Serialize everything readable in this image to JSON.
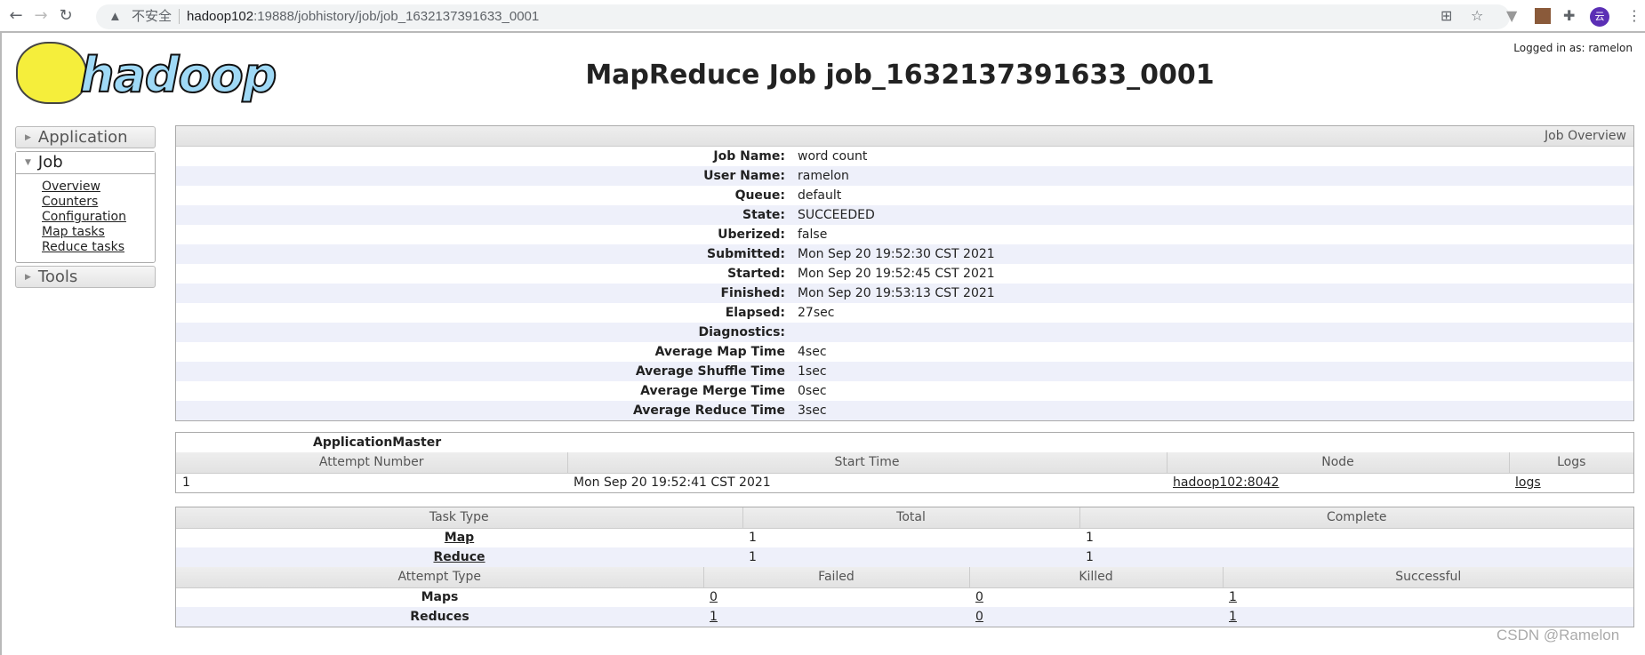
{
  "browser": {
    "insecure_label": "不安全",
    "url_host": "hadoop102",
    "url_rest": ":19888/jobhistory/job/job_1632137391633_0001",
    "avatar_letter": "云"
  },
  "header": {
    "logo_text": "hadoop",
    "title": "MapReduce Job job_1632137391633_0001",
    "logged_in": "Logged in as: ramelon"
  },
  "sidebar": {
    "application": "Application",
    "job": "Job",
    "tools": "Tools",
    "job_links": [
      "Overview",
      "Counters",
      "Configuration",
      "Map tasks",
      "Reduce tasks"
    ]
  },
  "overview": {
    "heading": "Job Overview",
    "rows": [
      {
        "k": "Job Name:",
        "v": "word count"
      },
      {
        "k": "User Name:",
        "v": "ramelon"
      },
      {
        "k": "Queue:",
        "v": "default"
      },
      {
        "k": "State:",
        "v": "SUCCEEDED"
      },
      {
        "k": "Uberized:",
        "v": "false"
      },
      {
        "k": "Submitted:",
        "v": "Mon Sep 20 19:52:30 CST 2021"
      },
      {
        "k": "Started:",
        "v": "Mon Sep 20 19:52:45 CST 2021"
      },
      {
        "k": "Finished:",
        "v": "Mon Sep 20 19:53:13 CST 2021"
      },
      {
        "k": "Elapsed:",
        "v": "27sec"
      },
      {
        "k": "Diagnostics:",
        "v": ""
      },
      {
        "k": "Average Map Time",
        "v": "4sec"
      },
      {
        "k": "Average Shuffle Time",
        "v": "1sec"
      },
      {
        "k": "Average Merge Time",
        "v": "0sec"
      },
      {
        "k": "Average Reduce Time",
        "v": "3sec"
      }
    ]
  },
  "app_master": {
    "title": "ApplicationMaster",
    "columns": [
      "Attempt Number",
      "Start Time",
      "Node",
      "Logs"
    ],
    "row": {
      "attempt": "1",
      "start": "Mon Sep 20 19:52:41 CST 2021",
      "node": "hadoop102:8042",
      "logs": "logs"
    }
  },
  "tasks": {
    "columns": [
      "Task Type",
      "Total",
      "Complete"
    ],
    "rows": [
      {
        "type": "Map",
        "total": "1",
        "complete": "1"
      },
      {
        "type": "Reduce",
        "total": "1",
        "complete": "1"
      }
    ],
    "attempt_columns": [
      "Attempt Type",
      "Failed",
      "Killed",
      "Successful"
    ],
    "attempt_rows": [
      {
        "type": "Maps",
        "failed": "0",
        "killed": "0",
        "successful": "1"
      },
      {
        "type": "Reduces",
        "failed": "1",
        "killed": "0",
        "successful": "1"
      }
    ]
  },
  "watermark": "CSDN @Ramelon"
}
